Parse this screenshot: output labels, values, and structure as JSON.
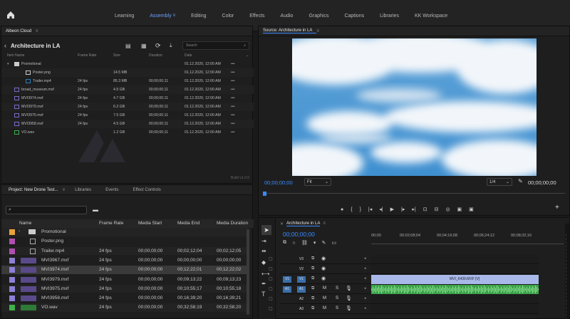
{
  "workspaces": [
    "Learning",
    "Assembly",
    "Editing",
    "Color",
    "Effects",
    "Audio",
    "Graphics",
    "Captions",
    "Libraries",
    "KK Workspace"
  ],
  "cloud": {
    "tab": "Albeon Cloud",
    "folder": "Architecture in LA",
    "search_placeholder": "Search",
    "columns": [
      "Item Name",
      "Frame Rate",
      "Size",
      "Duration",
      "Date"
    ],
    "rows": [
      {
        "name": "Promotional",
        "fps": "",
        "size": "",
        "dur": "",
        "date": "01.12.2020, 12:00 AM",
        "type": "folder"
      },
      {
        "name": "Poster.png",
        "fps": "",
        "size": "14.5 MB",
        "dur": "",
        "date": "01.12.2020, 12:00 AM",
        "type": "image"
      },
      {
        "name": "Trailer.mp4",
        "fps": "24 fps",
        "size": "85.3 MB",
        "dur": "00;00;00;11",
        "date": "01.12.2020, 12:00 AM",
        "type": "video"
      },
      {
        "name": "broad_museum.mxf",
        "fps": "24 fps",
        "size": "4.5 GB",
        "dur": "00;00;00;11",
        "date": "01.12.2020, 12:00 AM",
        "type": "clip"
      },
      {
        "name": "MVI3974.mxf",
        "fps": "24 fps",
        "size": "4.7 GB",
        "dur": "00;00;00;11",
        "date": "01.12.2020, 12:00 AM",
        "type": "clip"
      },
      {
        "name": "MVI3979.mxf",
        "fps": "24 fps",
        "size": "6.2 GB",
        "dur": "00;00;00;11",
        "date": "01.12.2020, 12:00 AM",
        "type": "clip"
      },
      {
        "name": "MVI3975.mxf",
        "fps": "24 fps",
        "size": "7.5 GB",
        "dur": "00;00;00;11",
        "date": "01.12.2020, 12:00 AM",
        "type": "clip"
      },
      {
        "name": "MVI3958.mxf",
        "fps": "24 fps",
        "size": "4.5 GB",
        "dur": "00;00;00;11",
        "date": "01.12.2020, 12:00 AM",
        "type": "clip"
      },
      {
        "name": "VO.wav",
        "fps": "",
        "size": "1.2 GB",
        "dur": "00;00;00;11",
        "date": "01.12.2020, 12:00 AM",
        "type": "audio"
      }
    ],
    "build": "Build v1.0.0"
  },
  "project": {
    "tabs": [
      "Project: New Drone Test...",
      "Libraries",
      "Events",
      "Effect Controls"
    ],
    "columns": [
      "Name",
      "Frame Rate",
      "Media Start",
      "Media End",
      "Media Duration"
    ],
    "rows": [
      {
        "name": "Promotional",
        "fps": "",
        "start": "",
        "end": "",
        "dur": "",
        "color": "#e8a33a",
        "kind": "folder"
      },
      {
        "name": "Poster.png",
        "fps": "",
        "start": "",
        "end": "",
        "dur": "",
        "color": "#b04fb0",
        "kind": "image"
      },
      {
        "name": "Trailer.mp4",
        "fps": "24 fps",
        "start": "00;00;00;00",
        "end": "00;02;12;04",
        "dur": "00;02;12;05",
        "color": "#b04fb0",
        "kind": "video"
      },
      {
        "name": "MVI3967.mxf",
        "fps": "24 fps",
        "start": "00;00;00;00",
        "end": "00;00;00;00",
        "dur": "00;00;00;00",
        "color": "#8f7fd6",
        "kind": "clip"
      },
      {
        "name": "MVI3974.mxf",
        "fps": "24 fps",
        "start": "00;00;00;00",
        "end": "00;12;22;01",
        "dur": "00;12;22;02",
        "color": "#8f7fd6",
        "kind": "clip"
      },
      {
        "name": "MVI3979.mxf",
        "fps": "24 fps",
        "start": "00;00;00;00",
        "end": "00;09;13;22",
        "dur": "00;09;13;23",
        "color": "#8f7fd6",
        "kind": "clip"
      },
      {
        "name": "MVI3975.mxf",
        "fps": "24 fps",
        "start": "00;00;00;00",
        "end": "00;10;55;17",
        "dur": "00;10;55;18",
        "color": "#8f7fd6",
        "kind": "clip"
      },
      {
        "name": "MVI3958.mxf",
        "fps": "24 fps",
        "start": "00;00;00;00",
        "end": "00;16;39;20",
        "dur": "00;16;39;21",
        "color": "#8f7fd6",
        "kind": "clip"
      },
      {
        "name": "VO.wav",
        "fps": "24 fps",
        "start": "00;00;00;00",
        "end": "00;32;58;19",
        "dur": "00;32;58;20",
        "color": "#3fb24a",
        "kind": "audio"
      }
    ]
  },
  "source": {
    "tab": "Source: Architecture in LA",
    "timecode_in": "00;00;00;00",
    "fit": "Fit",
    "resolution": "1/4",
    "timecode_out": "00;00;00;00"
  },
  "timeline": {
    "tab": "Architecture in LA",
    "timecode": "00;00;00;00",
    "ruler": [
      "00;00",
      "00;02;08;04",
      "00;04;16;08",
      "00;06;24;12",
      "00;08;32;16"
    ],
    "video_tracks": [
      "V3",
      "V2",
      "V1"
    ],
    "audio_tracks": [
      "A1",
      "A2",
      "A3"
    ],
    "clip_label": "MVI_6439.MXF [V]",
    "colors": {
      "video_clip": "#a8b8e8",
      "audio_clip": "#3aa24a",
      "accent": "#3b8bff"
    }
  }
}
